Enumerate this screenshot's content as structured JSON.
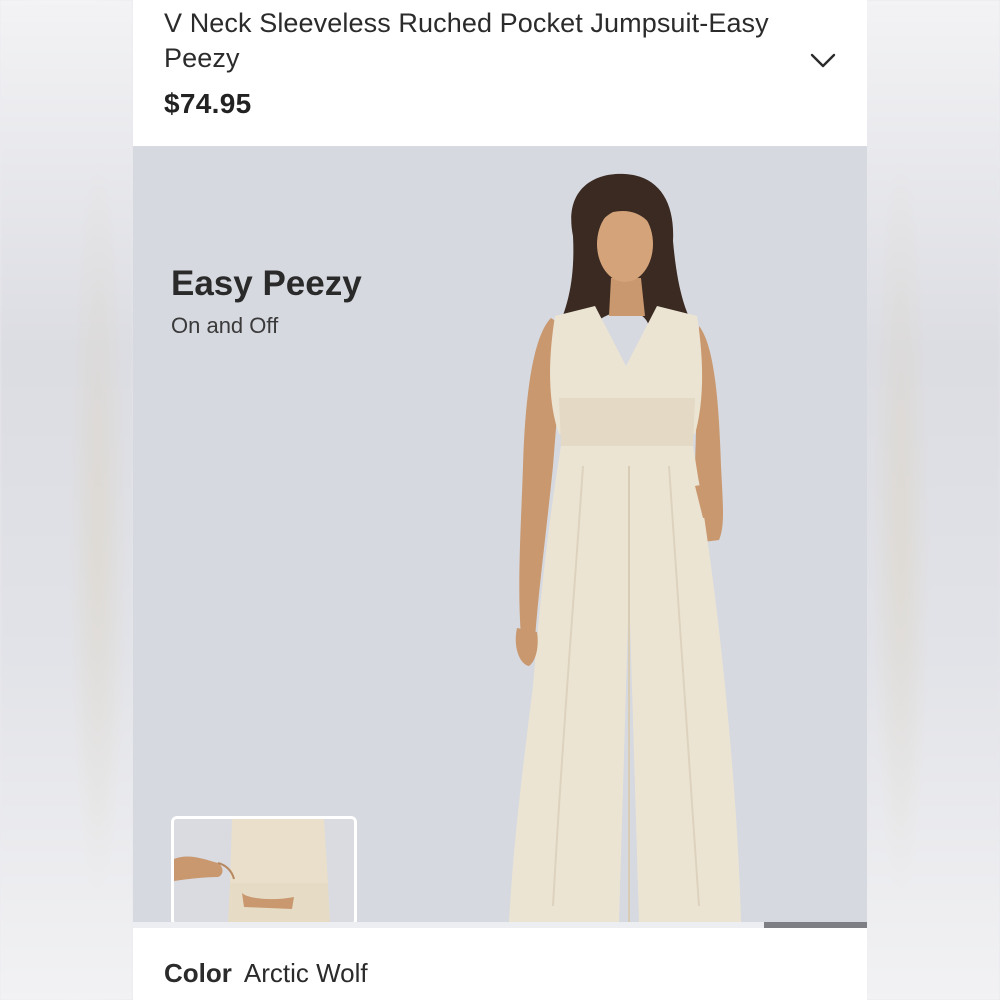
{
  "product": {
    "title": "V Neck Sleeveless Ruched Pocket Jumpsuit-Easy Peezy",
    "price": "$74.95"
  },
  "hero": {
    "heading": "Easy Peezy",
    "subheading": "On and Off"
  },
  "gallery": {
    "progress_fraction": 0.14
  },
  "color": {
    "label": "Color",
    "value": "Arctic Wolf"
  },
  "colors": {
    "hero_bg": "#d6d9e0",
    "garment": "#ece4d3",
    "text": "#2b2b2b"
  },
  "icons": {
    "expand": "chevron-down-icon"
  }
}
